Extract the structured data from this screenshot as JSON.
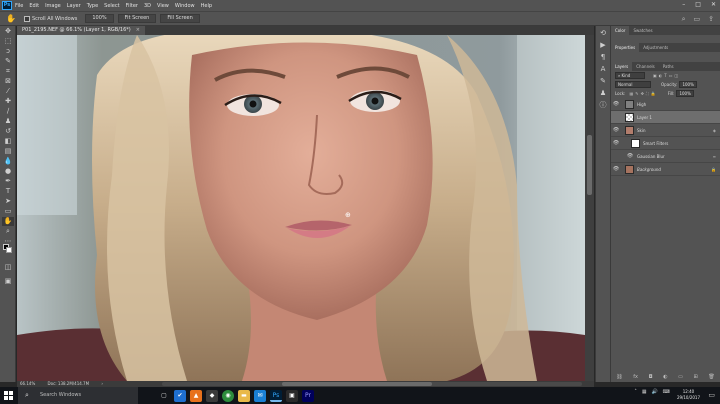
{
  "menubar": {
    "logo": "Ps",
    "items": [
      "File",
      "Edit",
      "Image",
      "Layer",
      "Type",
      "Select",
      "Filter",
      "3D",
      "View",
      "Window",
      "Help"
    ],
    "window_controls": [
      "–",
      "□",
      "✕"
    ]
  },
  "optionsbar": {
    "tool_icon": "hand-icon",
    "scroll_all_windows_label": "Scroll All Windows",
    "zoom_button": "100%",
    "fit_screen_button": "Fit Screen",
    "fill_screen_button": "Fill Screen"
  },
  "document": {
    "tab_title": "P01_2195.NEF @ 66.1% (Layer 1, RGB/16*)",
    "tab_close": "×",
    "status_zoom": "66.14%",
    "status_doc": "Doc: 138.2M/414.7M",
    "status_arrow": "›"
  },
  "panels": {
    "top_tabs": [
      "Color",
      "Swatches"
    ],
    "mid_tabs": [
      "Properties",
      "Adjustments"
    ],
    "layer_tabs": [
      "Layers",
      "Channels",
      "Paths"
    ],
    "kind_label": "Kind",
    "blend_mode": "Normal",
    "opacity_label": "Opacity:",
    "opacity_value": "100%",
    "lock_label": "Lock:",
    "fill_label": "Fill:",
    "fill_value": "100%",
    "layers": [
      {
        "name": "High",
        "type": "group",
        "visible": true,
        "selected": false
      },
      {
        "name": "Layer 1",
        "type": "pixel",
        "visible": false,
        "selected": true
      },
      {
        "name": "Skin",
        "type": "smart",
        "visible": true,
        "selected": false
      },
      {
        "name": "Smart Filters",
        "type": "filters",
        "visible": true,
        "selected": false
      },
      {
        "name": "Gaussian Blur",
        "type": "filter",
        "visible": true,
        "selected": false
      },
      {
        "name": "Background",
        "type": "background",
        "visible": true,
        "selected": false
      }
    ],
    "bottom_icons": [
      "link-icon",
      "fx-icon",
      "mask-icon",
      "adjustment-icon",
      "folder-icon",
      "new-layer-icon",
      "trash-icon"
    ]
  },
  "taskbar": {
    "search_placeholder": "Search Windows",
    "time": "12:40",
    "date": "29/10/2017"
  },
  "colors": {
    "ui_dark": "#535353",
    "ui_darker": "#3b3b3b",
    "accent_blue": "#31a8ff",
    "selected_layer": "#6e6e6e",
    "taskbar": "#111419"
  }
}
